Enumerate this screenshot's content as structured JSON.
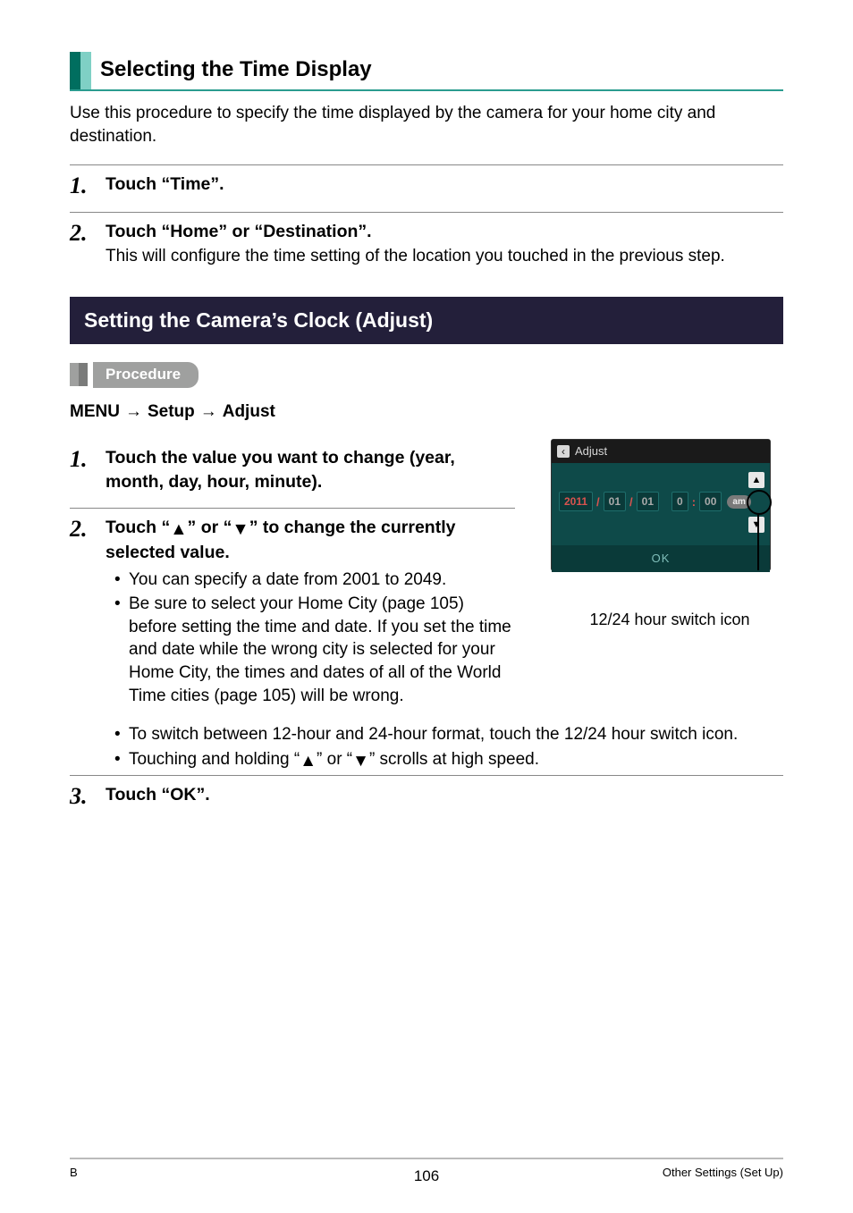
{
  "section1": {
    "title": "Selecting the Time Display",
    "intro": "Use this procedure to specify the time displayed by the camera for your home city and destination.",
    "steps": [
      {
        "num": "1.",
        "title": "Touch “Time”."
      },
      {
        "num": "2.",
        "title": "Touch “Home” or “Destination”.",
        "sub": "This will configure the time setting of the location you touched in the previous step."
      }
    ]
  },
  "section2": {
    "bar": "Setting the Camera’s Clock (Adjust)",
    "procedure_label": "Procedure",
    "breadcrumb": {
      "a": "MENU",
      "b": "Setup",
      "c": "Adjust"
    },
    "steps": {
      "s1": {
        "num": "1.",
        "title": "Touch the value you want to change (year, month, day, hour, minute)."
      },
      "s2": {
        "num": "2.",
        "title_pre": "Touch “",
        "title_mid": "” or “",
        "title_post": "” to change the currently selected value.",
        "bullets_narrow": [
          "You can specify a date from 2001 to 2049.",
          "Be sure to select your Home City (page 105) before setting the time and date. If you set the time and date while the wrong city is selected for your Home City, the times and dates of all of the World Time cities (page 105) will be wrong."
        ],
        "bullets_wide": [
          "To switch between 12-hour and 24-hour format, touch the 12/24 hour switch icon."
        ],
        "bullet_hold_pre": "Touching and holding “",
        "bullet_hold_mid": "” or “",
        "bullet_hold_post": "” scrolls at high speed."
      },
      "s3": {
        "num": "3.",
        "title": "Touch “OK”."
      }
    },
    "screenshot": {
      "header": "Adjust",
      "year": "2011",
      "mon": "01",
      "day": "01",
      "hour": "0",
      "min": "00",
      "slash": "/",
      "colon": ":",
      "ampm": "am",
      "ok": "OK",
      "caption": "12/24 hour switch icon"
    }
  },
  "footer": {
    "left": "B",
    "center": "106",
    "right": "Other Settings (Set Up)"
  },
  "glyphs": {
    "up": "▲",
    "down": "▼",
    "arrow": "→",
    "left_chev": "‹"
  }
}
